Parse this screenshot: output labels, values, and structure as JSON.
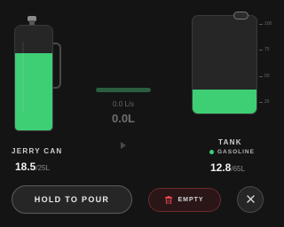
{
  "jerry_can": {
    "label": "JERRY CAN",
    "volume": "18.5",
    "capacity": "/25L",
    "fill_fraction": 0.74,
    "fill_color": "#3ecf75"
  },
  "flow": {
    "rate": "0.0 L/s",
    "total": "0.0L",
    "play_icon": "play-icon"
  },
  "tank": {
    "label": "TANK",
    "fuel_type": "GASOLINE",
    "volume": "12.8",
    "capacity": "/65L",
    "fill_fraction": 0.25,
    "scale_ticks": [
      "100",
      "75",
      "50",
      "25"
    ],
    "fill_color": "#3ecf75"
  },
  "actions": {
    "pour_label": "HOLD TO POUR",
    "empty_label": "EMPTY",
    "empty_icon": "trash-icon",
    "close_icon": "close-icon"
  },
  "colors": {
    "accent": "#3ecf75",
    "danger_border": "#6b2a2f",
    "danger_icon": "#e0454f",
    "background": "#141414"
  }
}
